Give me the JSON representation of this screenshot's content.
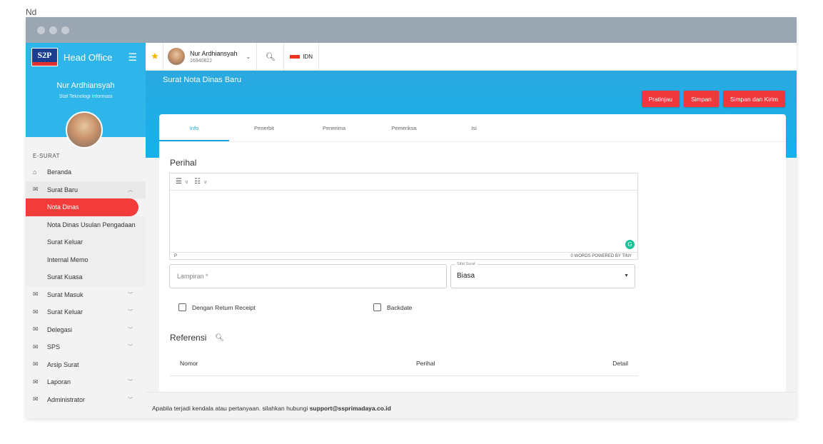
{
  "page_label": "Nd",
  "brand": {
    "logo_text": "S2P",
    "title": "Head Office"
  },
  "profile": {
    "name": "Nur Ardhiansyah",
    "role": "Staf Teknologi Informasi"
  },
  "sidebar": {
    "section_label": "E-SURAT",
    "items": [
      {
        "label": "Beranda",
        "icon": "home-icon",
        "chevron": ""
      },
      {
        "label": "Surat Baru",
        "icon": "mail-icon",
        "chevron": "^",
        "expanded": true
      },
      {
        "label": "Surat Masuk",
        "icon": "mail-icon",
        "chevron": "v"
      },
      {
        "label": "Surat Keluar",
        "icon": "mail-icon",
        "chevron": "v"
      },
      {
        "label": "Delegasi",
        "icon": "mail-icon",
        "chevron": "v"
      },
      {
        "label": "SPS",
        "icon": "mail-icon",
        "chevron": "v"
      },
      {
        "label": "Arsip Surat",
        "icon": "mail-icon",
        "chevron": ""
      },
      {
        "label": "Laporan",
        "icon": "mail-icon",
        "chevron": "v"
      },
      {
        "label": "Administrator",
        "icon": "mail-icon",
        "chevron": "v"
      }
    ],
    "subitems": [
      {
        "label": "Nota Dinas",
        "active": true
      },
      {
        "label": "Nota Dinas Usulan Pengadaan"
      },
      {
        "label": "Surat Keluar"
      },
      {
        "label": "Internal Memo"
      },
      {
        "label": "Surat Kuasa"
      }
    ]
  },
  "topbar": {
    "user_name": "Nur Ardhiansyah",
    "user_id": "1694082J",
    "lang": "IDN"
  },
  "header": {
    "title": "Surat Nota Dinas Baru",
    "buttons": {
      "preview": "Pratinjau",
      "save": "Simpan",
      "save_send": "Simpan dan Kirim"
    }
  },
  "tabs": [
    "Info",
    "Penerbit",
    "Penerima",
    "Pemeriksa",
    "Isi"
  ],
  "form": {
    "perihal_label": "Perihal",
    "editor_status_left": "P",
    "editor_status_right": "0 WORDS  POWERED BY TINY",
    "lampiran_placeholder": "Lampiran *",
    "sifat_legend": "Sifat Surat",
    "sifat_value": "Biasa",
    "checkbox_return": "Dengan Return Receipt",
    "checkbox_backdate": "Backdate",
    "referensi_label": "Referensi",
    "columns": [
      "Nomor",
      "Perihal",
      "Detail"
    ]
  },
  "footer": {
    "text": "Apabila terjadi kendala atau pertanyaan. silahkan hubungi ",
    "email": "support@ssprimadaya.co.id"
  },
  "colors": {
    "accent": "#2eb6ea",
    "danger": "#f0373c"
  }
}
